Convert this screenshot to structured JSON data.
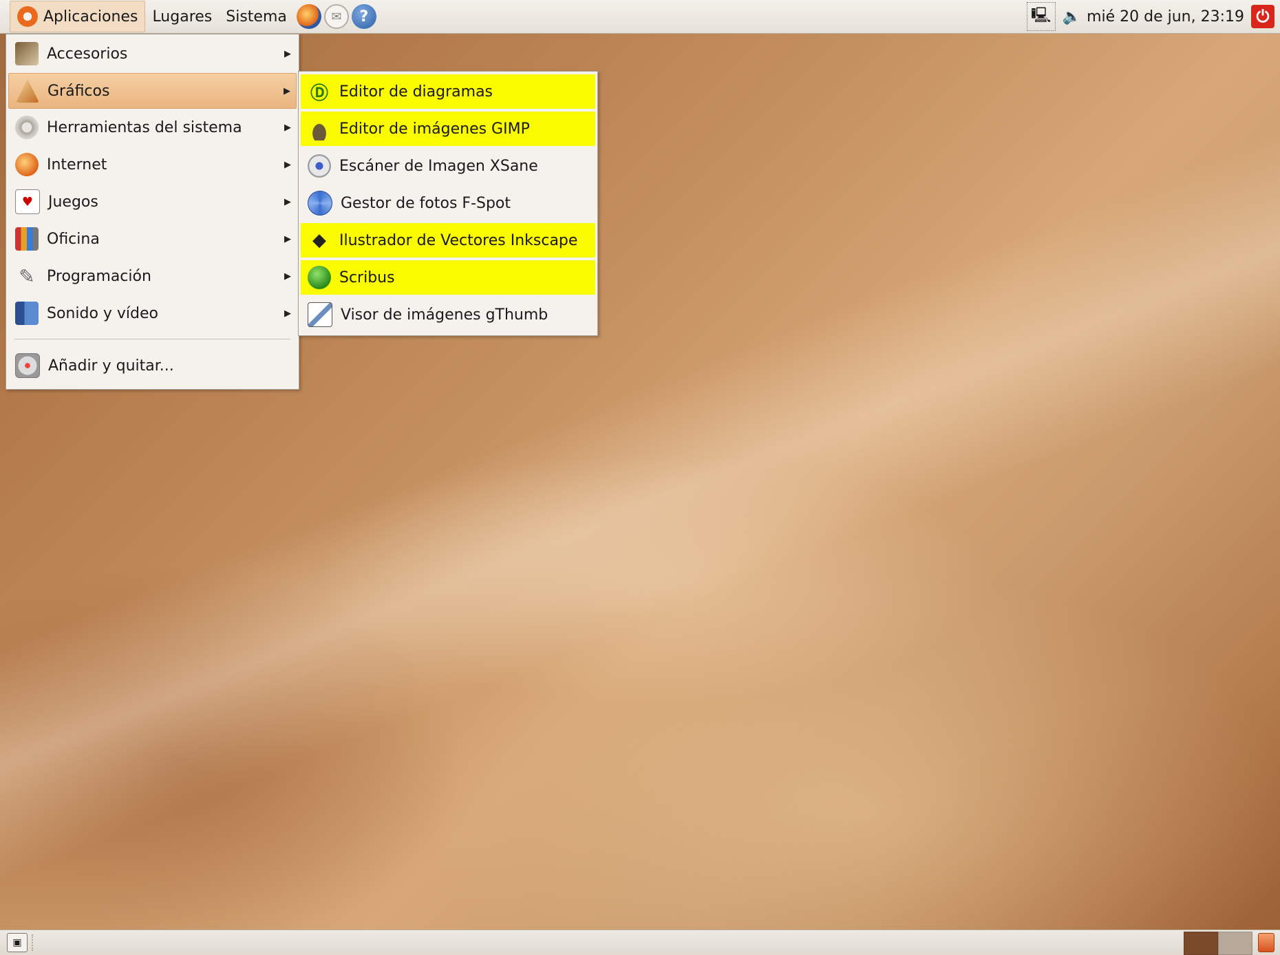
{
  "top_panel": {
    "menus": [
      "Aplicaciones",
      "Lugares",
      "Sistema"
    ],
    "launchers": [
      "firefox-icon",
      "mail-icon",
      "help-icon"
    ],
    "clock": "mié 20 de jun, 23:19"
  },
  "main_menu": {
    "items": [
      {
        "label": "Accesorios",
        "icon": "accessories-icon"
      },
      {
        "label": "Gráficos",
        "icon": "graphics-icon"
      },
      {
        "label": "Herramientas del sistema",
        "icon": "system-tools-icon"
      },
      {
        "label": "Internet",
        "icon": "internet-icon"
      },
      {
        "label": "Juegos",
        "icon": "games-icon"
      },
      {
        "label": "Oficina",
        "icon": "office-icon"
      },
      {
        "label": "Programación",
        "icon": "programming-icon"
      },
      {
        "label": "Sonido y vídeo",
        "icon": "sound-video-icon"
      }
    ],
    "add_remove": "Añadir y quitar..."
  },
  "graphics_submenu": {
    "items": [
      {
        "label": "Editor de diagramas",
        "icon": "dia-icon",
        "highlighted": true
      },
      {
        "label": "Editor de imágenes GIMP",
        "icon": "gimp-icon",
        "highlighted": true
      },
      {
        "label": "Escáner de Imagen XSane",
        "icon": "xsane-icon",
        "highlighted": false
      },
      {
        "label": "Gestor de fotos F-Spot",
        "icon": "fspot-icon",
        "highlighted": false
      },
      {
        "label": "Ilustrador de Vectores Inkscape",
        "icon": "inkscape-icon",
        "highlighted": true
      },
      {
        "label": "Scribus",
        "icon": "scribus-icon",
        "highlighted": true
      },
      {
        "label": "Visor de imágenes gThumb",
        "icon": "gthumb-icon",
        "highlighted": false
      }
    ]
  },
  "colors": {
    "highlight": "#fbfb00",
    "selection": "#eab580",
    "accent": "#e96a1c"
  }
}
